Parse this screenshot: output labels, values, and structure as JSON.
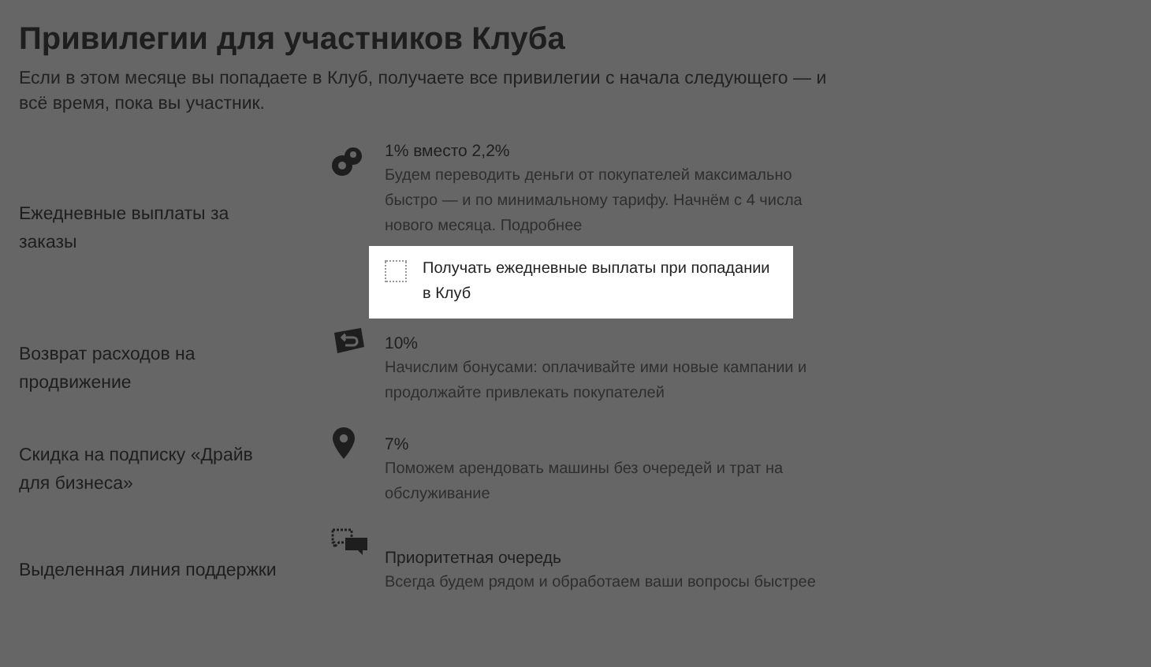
{
  "title": "Привилегии для участников Клуба",
  "intro": "Если в этом месяце вы попадаете в Клуб, получаете все привилегии с начала следующего — и всё время, пока вы участник.",
  "privileges": [
    {
      "label": "Ежедневные выплаты за заказы",
      "kind": "coins",
      "heading": "1% вместо 2,2%",
      "description": "Будем переводить деньги от покупателей максимально быстро — и по минимальному тарифу. Начнём с 4 числа нового месяца.",
      "link": "Подробнее",
      "checkbox": {
        "label": "Получать ежедневные выплаты при попадании в Клуб",
        "checked": false
      }
    },
    {
      "label": "Возврат расходов на продвижение",
      "kind": "ticket",
      "heading": "10%",
      "description": "Начислим бонусами: оплачивайте ими новые кампании и продолжайте привлекать покупателей"
    },
    {
      "label": "Скидка на подписку «Драйв для бизнеса»",
      "kind": "pin",
      "heading": "7%",
      "description": "Поможем арендовать машины без очередей и трат на обслуживание"
    },
    {
      "label": "Выделенная линия поддержки",
      "kind": "chat",
      "heading": "Приоритетная очередь",
      "description": "Всегда будем рядом и обработаем ваши вопросы быстрее"
    }
  ]
}
